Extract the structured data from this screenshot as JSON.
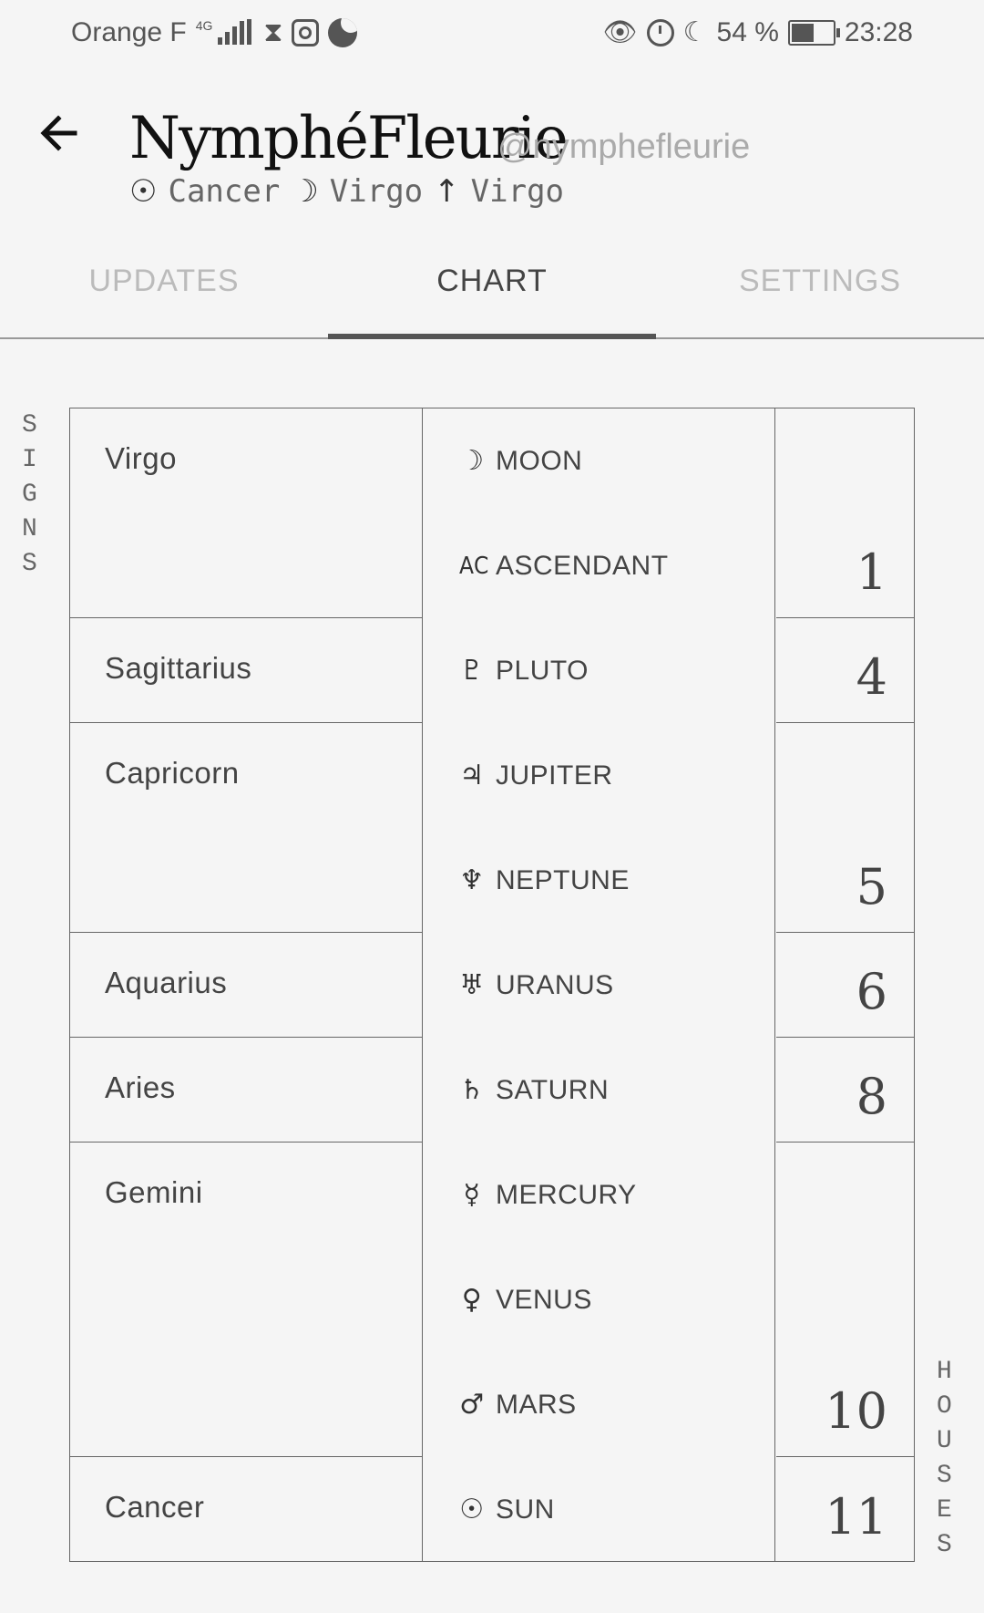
{
  "status_bar": {
    "carrier": "Orange F",
    "network": "4G",
    "battery": "54 %",
    "battery_level": 0.54,
    "time": "23:28",
    "icons_left": [
      "signal-icon",
      "hourglass-icon",
      "instagram-icon",
      "moon-phase-icon"
    ],
    "icons_right": [
      "eye-icon",
      "alarm-icon",
      "do-not-disturb-icon",
      "battery-icon"
    ]
  },
  "header": {
    "back_icon": "arrow-left-icon",
    "name": "NymphéFleurie",
    "handle": "@nymphefleurie",
    "big_three": [
      {
        "icon": "sun-icon",
        "symbol": "☉",
        "sign": "Cancer"
      },
      {
        "icon": "moon-icon",
        "symbol": "☽",
        "sign": "Virgo"
      },
      {
        "icon": "ascendant-arrow-icon",
        "symbol": "↑",
        "sign": "Virgo"
      }
    ]
  },
  "tabs": [
    {
      "label": "UPDATES",
      "active": false
    },
    {
      "label": "CHART",
      "active": true
    },
    {
      "label": "SETTINGS",
      "active": false
    }
  ],
  "chart": {
    "signs_label": "SIGNS",
    "houses_label": "HOUSES",
    "signs": [
      "Virgo",
      "Sagittarius",
      "Capricorn",
      "Aquarius",
      "Aries",
      "Gemini",
      "Cancer"
    ],
    "planets": [
      {
        "symbol": "☽",
        "icon": "moon-icon",
        "name": "MOON"
      },
      {
        "symbol": "AC",
        "icon": "ascendant-icon",
        "name": "ASCENDANT"
      },
      {
        "symbol": "♇",
        "icon": "pluto-icon",
        "name": "PLUTO"
      },
      {
        "symbol": "♃",
        "icon": "jupiter-icon",
        "name": "JUPITER"
      },
      {
        "symbol": "♆",
        "icon": "neptune-icon",
        "name": "NEPTUNE"
      },
      {
        "symbol": "♅",
        "icon": "uranus-icon",
        "name": "URANUS"
      },
      {
        "symbol": "♄",
        "icon": "saturn-icon",
        "name": "SATURN"
      },
      {
        "symbol": "☿",
        "icon": "mercury-icon",
        "name": "MERCURY"
      },
      {
        "symbol": "♀",
        "icon": "venus-icon",
        "name": "VENUS"
      },
      {
        "symbol": "♂",
        "icon": "mars-icon",
        "name": "MARS"
      },
      {
        "symbol": "☉",
        "icon": "sun-icon",
        "name": "SUN"
      }
    ],
    "houses": [
      "1",
      "4",
      "5",
      "6",
      "8",
      "10",
      "11"
    ]
  }
}
